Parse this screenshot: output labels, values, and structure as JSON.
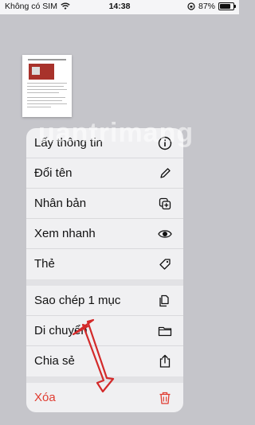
{
  "status": {
    "carrier": "Không có SIM",
    "time": "14:38",
    "battery": "87%"
  },
  "watermark": "uantrimang",
  "menu": {
    "items": [
      {
        "label": "Lấy thông tin",
        "icon": "info-icon"
      },
      {
        "label": "Đổi tên",
        "icon": "pencil-icon"
      },
      {
        "label": "Nhân bản",
        "icon": "duplicate-icon"
      },
      {
        "label": "Xem nhanh",
        "icon": "eye-icon"
      },
      {
        "label": "Thẻ",
        "icon": "tag-icon"
      },
      {
        "label": "Sao chép 1 mục",
        "icon": "copy-icon"
      },
      {
        "label": "Di chuyển",
        "icon": "folder-icon"
      },
      {
        "label": "Chia sẻ",
        "icon": "share-icon"
      },
      {
        "label": "Xóa",
        "icon": "trash-icon",
        "danger": true
      }
    ]
  }
}
